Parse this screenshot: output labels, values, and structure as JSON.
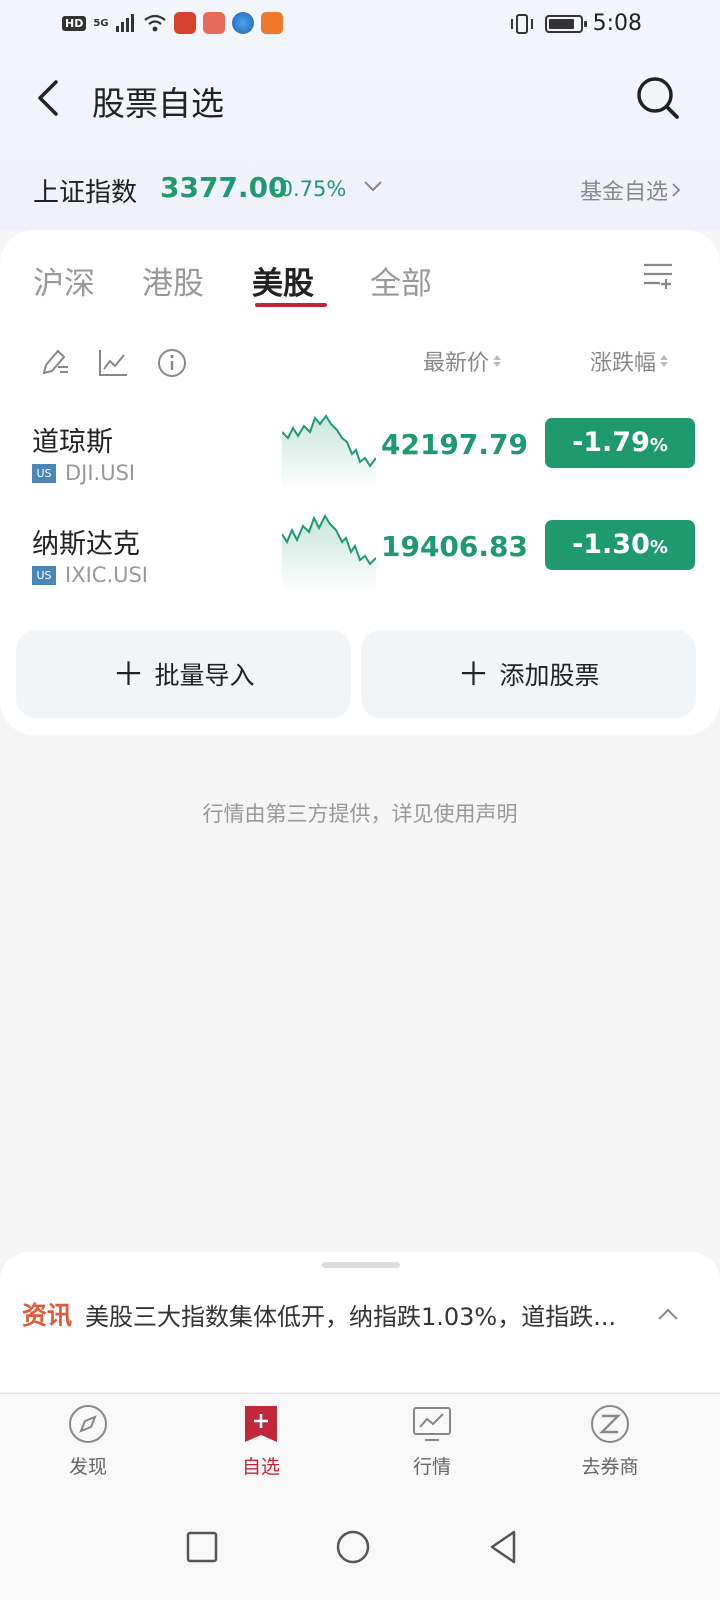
{
  "status_bar": {
    "hd": "HD",
    "network": "5G",
    "time": "5:08",
    "battery_level": 0.85
  },
  "header": {
    "title": "股票自选"
  },
  "index": {
    "name": "上证指数",
    "value": "3377.00",
    "change": "-0.75%",
    "fund_link": "基金自选"
  },
  "tabs": [
    {
      "label": "沪深"
    },
    {
      "label": "港股"
    },
    {
      "label": "美股"
    },
    {
      "label": "全部"
    }
  ],
  "active_tab": "美股",
  "columns": {
    "price": "最新价",
    "change": "涨跌幅"
  },
  "stocks": [
    {
      "name": "道琼斯",
      "market": "US",
      "code": "DJI.USI",
      "price": "42197.79",
      "change": "-1.79",
      "change_unit": "%"
    },
    {
      "name": "纳斯达克",
      "market": "US",
      "code": "IXIC.USI",
      "price": "19406.83",
      "change": "-1.30",
      "change_unit": "%"
    }
  ],
  "actions": {
    "batch_import": "批量导入",
    "add_stock": "添加股票"
  },
  "disclaimer": "行情由第三方提供，详见使用声明",
  "news": {
    "tag": "资讯",
    "text": "美股三大指数集体低开，纳指跌1.03%，道指跌..."
  },
  "bottom_nav": [
    {
      "label": "发现",
      "icon": "compass-icon"
    },
    {
      "label": "自选",
      "icon": "bookmark-plus-icon"
    },
    {
      "label": "行情",
      "icon": "chart-monitor-icon"
    },
    {
      "label": "去券商",
      "icon": "broker-icon"
    }
  ],
  "colors": {
    "down_green": "#1f9a6f",
    "accent_red": "#c0273b",
    "news_orange": "#e05a38"
  }
}
